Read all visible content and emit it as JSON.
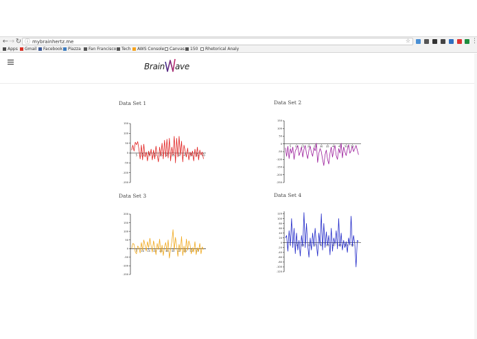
{
  "browser": {
    "url": "mybrainhertz.me",
    "bookmarks": [
      "Apps",
      "Gmail",
      "Facebook",
      "Piazza",
      "Fan Francisco",
      "Tech",
      "AWS Console",
      "Canvas",
      "150",
      "Rhetorical Analy"
    ]
  },
  "logo": {
    "part1": "Brain",
    "part2": "ave"
  },
  "colors": {
    "set1": "#e0201f",
    "set2": "#9a1b9a",
    "set3": "#f0a81c",
    "set4": "#1f27c8"
  },
  "chart_data": [
    {
      "title": "Data Set 1",
      "type": "line",
      "color": "#e0201f",
      "yticks": [
        150,
        100,
        50,
        0,
        -50,
        -100,
        -150
      ],
      "ylim": [
        -150,
        150
      ],
      "xticks": [
        5,
        10,
        15,
        20,
        25,
        30,
        35,
        40,
        45,
        50,
        55,
        60
      ],
      "xlim": [
        0,
        62
      ],
      "x": [
        1,
        2,
        3,
        4,
        5,
        6,
        7,
        8,
        9,
        10,
        11,
        12,
        13,
        14,
        15,
        16,
        17,
        18,
        19,
        20,
        21,
        22,
        23,
        24,
        25,
        26,
        27,
        28,
        29,
        30,
        31,
        32,
        33,
        34,
        35,
        36,
        37,
        38,
        39,
        40,
        41,
        42,
        43,
        44,
        45,
        46,
        47,
        48,
        49,
        50,
        51,
        52,
        53,
        54,
        55,
        56,
        57,
        58,
        59,
        60
      ],
      "values": [
        15,
        40,
        10,
        55,
        42,
        58,
        20,
        -30,
        40,
        -35,
        45,
        -20,
        5,
        -40,
        10,
        -15,
        20,
        -35,
        15,
        -30,
        35,
        -10,
        -45,
        30,
        -15,
        50,
        -30,
        65,
        -20,
        70,
        -25,
        75,
        -40,
        30,
        -10,
        85,
        -50,
        75,
        -20,
        85,
        -10,
        60,
        -45,
        40,
        10,
        -20,
        25,
        -35,
        5,
        -15,
        10,
        -40,
        20,
        -20,
        30,
        -35,
        15,
        -10,
        5,
        -30
      ]
    },
    {
      "title": "Data Set 2",
      "type": "line",
      "color": "#9a1b9a",
      "yticks": [
        150,
        100,
        50,
        0,
        -50,
        -100,
        -150,
        -200,
        -250
      ],
      "ylim": [
        -250,
        150
      ],
      "xticks": [
        5,
        10,
        15,
        20,
        25,
        30,
        35,
        40,
        45,
        50,
        55
      ],
      "xlim": [
        0,
        62
      ],
      "x": [
        1,
        2,
        3,
        4,
        5,
        6,
        7,
        8,
        9,
        10,
        11,
        12,
        13,
        14,
        15,
        16,
        17,
        18,
        19,
        20,
        21,
        22,
        23,
        24,
        25,
        26,
        27,
        28,
        29,
        30,
        31,
        32,
        33,
        34,
        35,
        36,
        37,
        38,
        39,
        40,
        41,
        42,
        43,
        44,
        45,
        46,
        47,
        48,
        49,
        50,
        51,
        52,
        53,
        54,
        55,
        56,
        57,
        58,
        59,
        60
      ],
      "values": [
        -25,
        -80,
        -15,
        -95,
        -30,
        -60,
        -20,
        -100,
        -45,
        -30,
        -10,
        -75,
        -50,
        -20,
        -85,
        -35,
        -10,
        -60,
        -95,
        -40,
        -15,
        -55,
        -80,
        -25,
        -45,
        5,
        -120,
        -60,
        -30,
        -50,
        -100,
        -140,
        -70,
        -40,
        -100,
        -130,
        -60,
        -20,
        -85,
        -40,
        -10,
        -75,
        -100,
        -30,
        -60,
        5,
        -90,
        -20,
        -50,
        -75,
        -35,
        -5,
        -60,
        -45,
        -15,
        -50,
        -30,
        -10,
        -40,
        -70
      ]
    },
    {
      "title": "Data Set 3",
      "type": "line",
      "color": "#f0a81c",
      "yticks": [
        200,
        150,
        100,
        50,
        0,
        -50,
        -100,
        -150
      ],
      "ylim": [
        -150,
        200
      ],
      "xticks": [
        5,
        10,
        15,
        20,
        25,
        30,
        35,
        40,
        45,
        50,
        55
      ],
      "xlim": [
        0,
        62
      ],
      "x": [
        1,
        2,
        3,
        4,
        5,
        6,
        7,
        8,
        9,
        10,
        11,
        12,
        13,
        14,
        15,
        16,
        17,
        18,
        19,
        20,
        21,
        22,
        23,
        24,
        25,
        26,
        27,
        28,
        29,
        30,
        31,
        32,
        33,
        34,
        35,
        36,
        37,
        38,
        39,
        40,
        41,
        42,
        43,
        44,
        45,
        46,
        47,
        48,
        49,
        50,
        51,
        52,
        53,
        54,
        55,
        56,
        57,
        58,
        59,
        60
      ],
      "values": [
        0,
        30,
        25,
        -20,
        -30,
        15,
        5,
        -25,
        35,
        -10,
        50,
        20,
        -15,
        40,
        5,
        60,
        15,
        -20,
        45,
        10,
        -35,
        30,
        -5,
        55,
        -25,
        20,
        -40,
        10,
        35,
        -15,
        50,
        -55,
        -5,
        40,
        110,
        -10,
        65,
        15,
        -45,
        25,
        -15,
        70,
        -40,
        15,
        -25,
        55,
        -10,
        45,
        20,
        -30,
        5,
        -20,
        40,
        -35,
        5,
        -15,
        30,
        -30,
        10,
        -5
      ]
    },
    {
      "title": "Data Set 4",
      "type": "line",
      "color": "#1f27c8",
      "yticks": [
        120,
        100,
        80,
        60,
        40,
        20,
        0,
        -20,
        -40,
        -60,
        -80,
        -100,
        -120
      ],
      "ylim": [
        -120,
        130
      ],
      "xticks": [
        5,
        10,
        15,
        20,
        25,
        30,
        35,
        40,
        45,
        50,
        55
      ],
      "xlim": [
        0,
        62
      ],
      "x": [
        1,
        2,
        3,
        4,
        5,
        6,
        7,
        8,
        9,
        10,
        11,
        12,
        13,
        14,
        15,
        16,
        17,
        18,
        19,
        20,
        21,
        22,
        23,
        24,
        25,
        26,
        27,
        28,
        29,
        30,
        31,
        32,
        33,
        34,
        35,
        36,
        37,
        38,
        39,
        40,
        41,
        42,
        43,
        44,
        45,
        46,
        47,
        48,
        49,
        50,
        51,
        52,
        53,
        54,
        55,
        56,
        57,
        58,
        59,
        60
      ],
      "values": [
        20,
        30,
        -35,
        50,
        -10,
        100,
        -20,
        60,
        -45,
        40,
        -30,
        10,
        -55,
        30,
        -15,
        125,
        -20,
        80,
        -10,
        -60,
        20,
        -30,
        40,
        -15,
        60,
        -5,
        -55,
        40,
        -10,
        120,
        -30,
        80,
        -20,
        45,
        -10,
        30,
        -50,
        60,
        -35,
        20,
        -5,
        50,
        -25,
        100,
        -15,
        40,
        -30,
        10,
        -20,
        5,
        -40,
        20,
        -10,
        110,
        -15,
        30,
        -5,
        -100,
        10,
        5
      ]
    }
  ]
}
